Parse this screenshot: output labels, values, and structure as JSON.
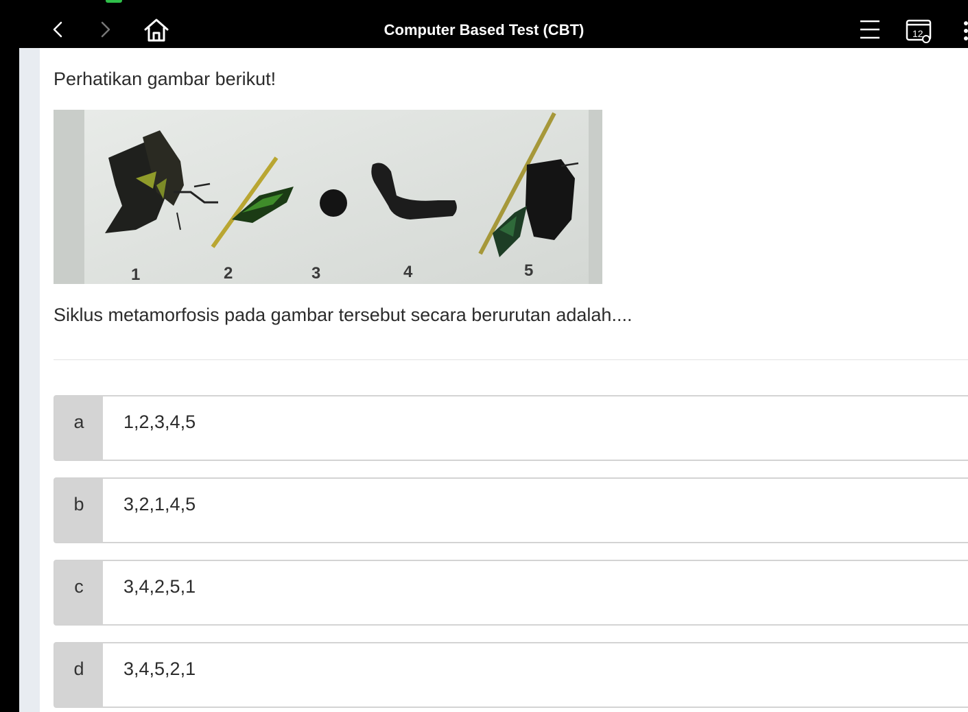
{
  "header": {
    "title": "Computer Based Test (CBT)",
    "calendar_badge": "12"
  },
  "question": {
    "intro": "Perhatikan gambar berikut!",
    "figure_labels": [
      "1",
      "2",
      "3",
      "4",
      "5"
    ],
    "text": "Siklus metamorfosis pada gambar tersebut secara berurutan adalah...."
  },
  "options": [
    {
      "letter": "a",
      "text": "1,2,3,4,5"
    },
    {
      "letter": "b",
      "text": "3,2,1,4,5"
    },
    {
      "letter": "c",
      "text": "3,4,2,5,1"
    },
    {
      "letter": "d",
      "text": "3,4,5,2,1"
    }
  ],
  "colors": {
    "header_bg": "#000000",
    "option_letter_bg": "#d4d4d4",
    "side_strip": "#e8ecf1"
  },
  "icons": [
    "chevron-left-icon",
    "chevron-right-icon",
    "home-icon",
    "menu-icon",
    "calendar-icon",
    "more-vertical-icon"
  ]
}
